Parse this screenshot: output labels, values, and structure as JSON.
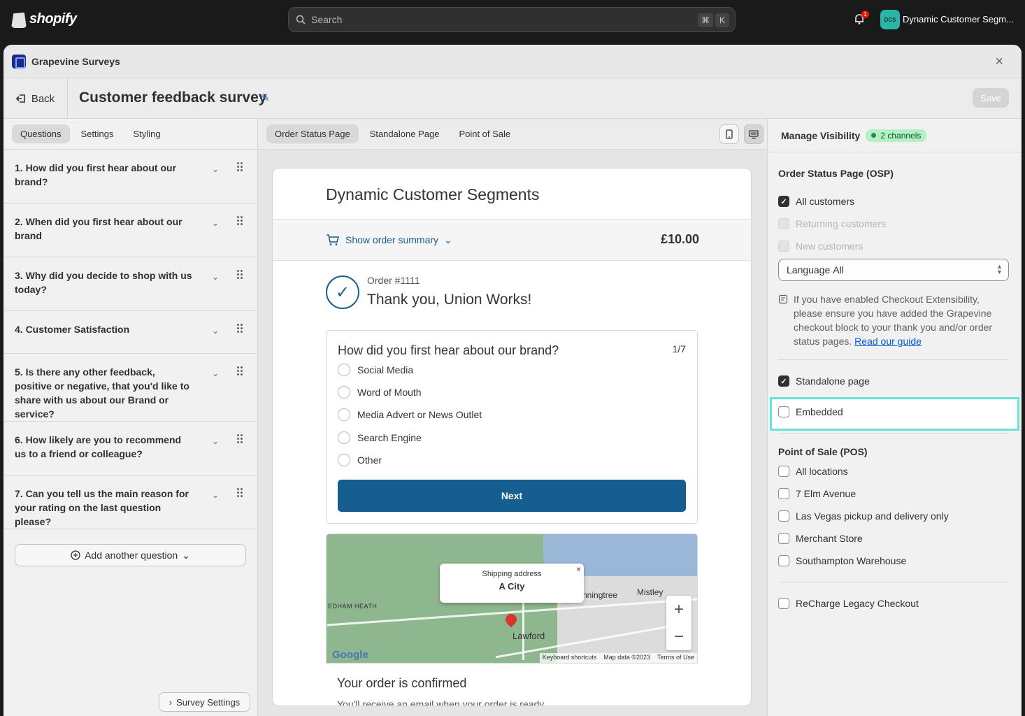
{
  "topbar": {
    "brand": "shopify",
    "search_placeholder": "Search",
    "shortcut_keys": [
      "⌘",
      "K"
    ],
    "notification_count": "1",
    "store_initials": "DCS",
    "store_name": "Dynamic Customer Segm..."
  },
  "app": {
    "title": "Grapevine Surveys",
    "close_label": "×"
  },
  "header": {
    "back_label": "Back",
    "title": "Customer feedback survey",
    "save_label": "Save"
  },
  "left": {
    "tabs": [
      {
        "label": "Questions",
        "active": true
      },
      {
        "label": "Settings",
        "active": false
      },
      {
        "label": "Styling",
        "active": false
      }
    ],
    "questions": [
      "1. How did you first hear about our brand?",
      "2. When did you first hear about our brand",
      "3. Why did you decide to shop with us today?",
      "4. Customer Satisfaction",
      "5. Is there any other feedback, positive or negative, that you'd like to share with us about our Brand or service?",
      "6. How likely are you to recommend us to a friend or colleague?",
      "7. Can you tell us the main reason for your rating on the last question please?"
    ],
    "add_question_label": "Add another question",
    "survey_settings_label": "Survey Settings"
  },
  "center": {
    "tabs": [
      {
        "label": "Order Status Page",
        "active": true
      },
      {
        "label": "Standalone Page",
        "active": false
      },
      {
        "label": "Point of Sale",
        "active": false
      }
    ],
    "preview": {
      "shop_name": "Dynamic Customer Segments",
      "show_summary": "Show order summary",
      "price": "£10.00",
      "order_number": "Order #1111",
      "thanks": "Thank you, Union Works!",
      "survey_question": "How did you first hear about our brand?",
      "survey_count": "1/7",
      "options": [
        "Social Media",
        "Word of Mouth",
        "Media Advert or News Outlet",
        "Search Engine",
        "Other"
      ],
      "next_label": "Next",
      "map": {
        "popup_line1": "Shipping address",
        "popup_line2": "A City",
        "labels": [
          "Mistley",
          "nningtree",
          "Lawford",
          "EDHAM HEATH"
        ],
        "footer": [
          "Keyboard shortcuts",
          "Map data ©2023",
          "Terms of Use"
        ],
        "google": "Google"
      },
      "confirmed_title": "Your order is confirmed",
      "confirmed_sub": "You'll receive an email when your order is ready."
    }
  },
  "right": {
    "title": "Manage Visibility",
    "badge": "2 channels",
    "osp_title": "Order Status Page (OSP)",
    "osp_options": [
      {
        "label": "All customers",
        "checked": true,
        "disabled": false
      },
      {
        "label": "Returning customers",
        "checked": false,
        "disabled": true
      },
      {
        "label": "New customers",
        "checked": false,
        "disabled": true
      }
    ],
    "language_label": "Language",
    "language_value": "All",
    "note": "If you have enabled Checkout Extensibility, please ensure you have added the Grapevine checkout block to your thank you and/or order status pages.",
    "note_link": "Read our guide",
    "standalone_label": "Standalone page",
    "embedded_label": "Embedded",
    "pos_title": "Point of Sale (POS)",
    "pos_options": [
      "All locations",
      "7 Elm Avenue",
      "Las Vegas pickup and delivery only",
      "Merchant Store",
      "Southampton Warehouse"
    ],
    "recharge_label": "ReCharge Legacy Checkout"
  },
  "colors": {
    "accent": "#155e8f",
    "highlight": "#66e4d8",
    "badge_bg": "#b4f0c4"
  }
}
